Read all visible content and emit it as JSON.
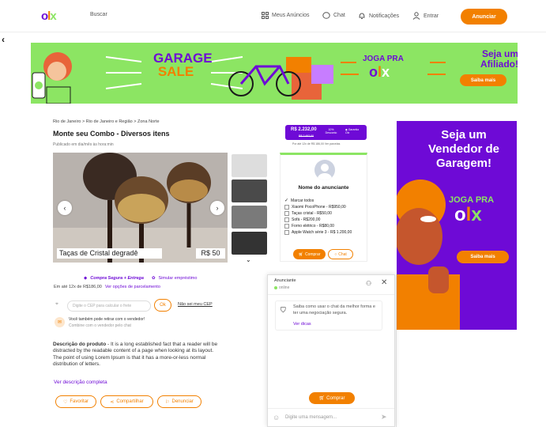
{
  "header": {
    "search": "Buscar",
    "meus_anuncios": "Meus Anúncios",
    "chat": "Chat",
    "notificacoes": "Notificações",
    "entrar": "Entrar",
    "anunciar": "Anunciar"
  },
  "banner": {
    "garage": "GARAGE",
    "sale": "SALE",
    "joga": "JOGA PRA",
    "seja": "Seja um Afiliado!",
    "saiba": "Saiba mais"
  },
  "breadcrumb": "Rio de Janeiro > Rio de Janeiro e Região > Zona Norte",
  "title": "Monte seu Combo - Diversos itens",
  "published": "Publicado em dia/mês às hora:min",
  "image": {
    "caption": "Taças de Cristal degradê",
    "price": "R$ 50"
  },
  "safe": {
    "label": "Compra Segura + Entrega",
    "simular": "Simular empréstimo",
    "parcel": "Em até 12x de R$186,00",
    "ver_opcoes": "Ver opções de parcelamento"
  },
  "cep": {
    "placeholder": "Digite o CEP para calcular o frete",
    "ok": "Ok",
    "nao_sei": "Não sei meu CEP"
  },
  "retirar": {
    "line1": "Você também pode retirar com o vendedor!",
    "line2": "Combine com o vendedor pelo chat"
  },
  "description": {
    "label": "Descrição do produto",
    "text": " - It is a long established fact that a reader will be distracted by the readable content of a page when looking at its layout. The point of using Lorem Ipsum is that it has a more-or-less normal distribution of letters.",
    "ver": "Ver descrição completa"
  },
  "actions": {
    "favoritar": "Favoritar",
    "compartilhar": "Compartilhar",
    "denunciar": "Denunciar"
  },
  "price_card": {
    "price": "R$ 2.232,00",
    "old": "R$ 2.492,00",
    "desconto": "10% Desconto",
    "garantia": "Garantia Olx",
    "note": "Por até 12x de R$ 186,00   Ver parcelas"
  },
  "advertiser": {
    "name": "Nome do anunciante",
    "items": [
      "Marcar todos",
      "Xiaomi PocoPhone - R$950,00",
      "Taças cristal - R$50,00",
      "Sofá - R$200,00",
      "Forno elétrico - R$80,00",
      "Apple Watch série 3 - R$ 1.200,00"
    ],
    "comprar": "Comprar",
    "chat": "Chat"
  },
  "chat": {
    "title": "Anunciante",
    "status": "online",
    "msg": "Saiba como usar o chat da melhor forma e ter uma negociação segura.",
    "ver": "Ver dicas",
    "comprar": "Comprar",
    "placeholder": "Digite uma mensagem..."
  },
  "rbanner": {
    "title": "Seja um Vendedor de Garagem!",
    "joga": "JOGA PRA",
    "saiba": "Saiba mais"
  },
  "colors": {
    "purple": "#6e0ad6",
    "orange": "#f28000",
    "green": "#8ce563"
  }
}
